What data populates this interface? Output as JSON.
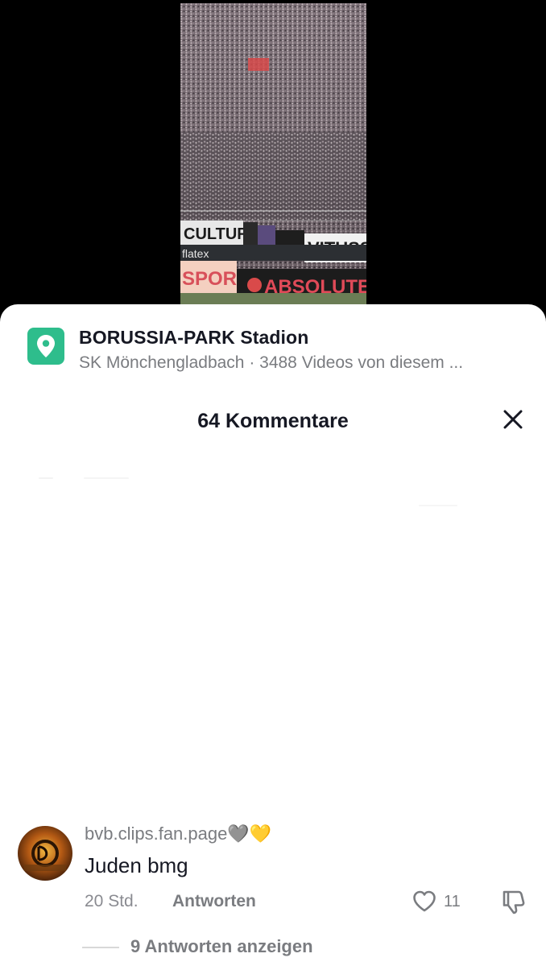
{
  "location": {
    "icon": "location-pin-icon",
    "accent": "#2ebd8c",
    "title": "BORUSSIA-PARK Stadion",
    "subtitle": "SK Mönchengladbach · 3488 Videos von diesem ..."
  },
  "comments_header": {
    "title": "64 Kommentare",
    "close_icon": "close-icon"
  },
  "video": {
    "banner_cultura": "CULTURA",
    "banner_vituss": "VITUSS",
    "ad_sport": "SPORT",
    "ad_absolute": "ABSOLUTE",
    "ad_flatex": "flatex"
  },
  "comment": {
    "username": "bvb.clips.fan.page🩶💛",
    "text": "Juden bmg",
    "time": "20 Std.",
    "reply_label": "Antworten",
    "like_count": "11",
    "view_replies": "9 Antworten anzeigen"
  }
}
